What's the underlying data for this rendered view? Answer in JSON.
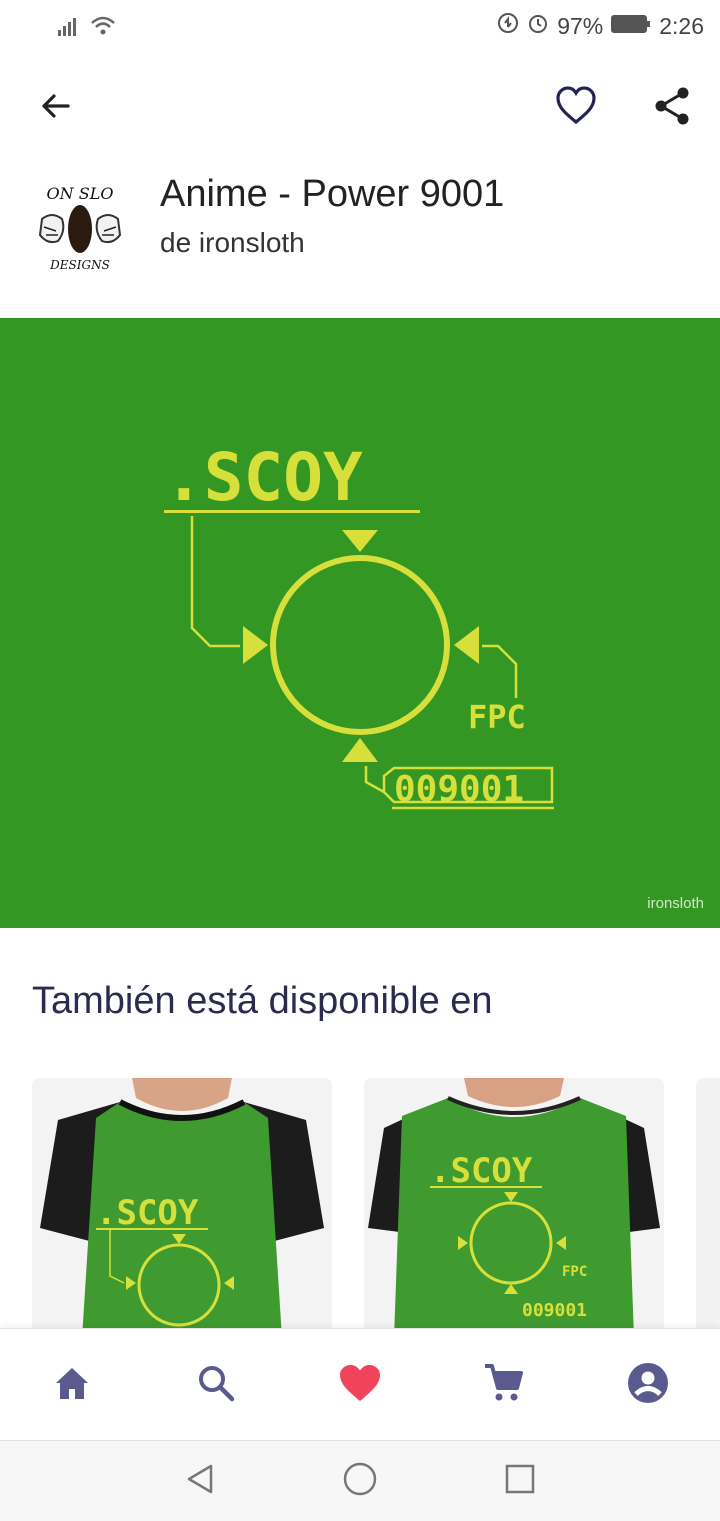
{
  "status_bar": {
    "battery_text": "97%",
    "time": "2:26",
    "icons": [
      "signal-icon",
      "wifi-icon",
      "data-saver-icon",
      "alarm-icon",
      "battery-icon"
    ]
  },
  "app_bar": {
    "icons": [
      "back-arrow-icon",
      "heart-outline-icon",
      "share-icon"
    ]
  },
  "product": {
    "title": "Anime - Power 9001",
    "subtitle": "de ironsloth",
    "avatar_lettering_top": "ON SLO",
    "avatar_lettering_bottom": "DESIGNS"
  },
  "artwork": {
    "bg_color": "#349623",
    "fg_color": "#d7e03a",
    "top_code": ".SCOY",
    "power_readout": "009001",
    "side_code": "FPC",
    "watermark": "ironsloth"
  },
  "also_available": {
    "title": "También está disponible en",
    "cards": [
      {
        "name": "graphic-tshirt-1"
      },
      {
        "name": "graphic-tshirt-2"
      }
    ]
  },
  "bottom_nav": {
    "items": [
      "home-icon",
      "search-icon",
      "heart-icon",
      "cart-icon",
      "account-icon"
    ],
    "accent": "#5a5a8f",
    "heart_color": "#f0445b"
  },
  "system_nav": {
    "items": [
      "back-triangle-icon",
      "home-circle-icon",
      "recents-square-icon"
    ]
  }
}
